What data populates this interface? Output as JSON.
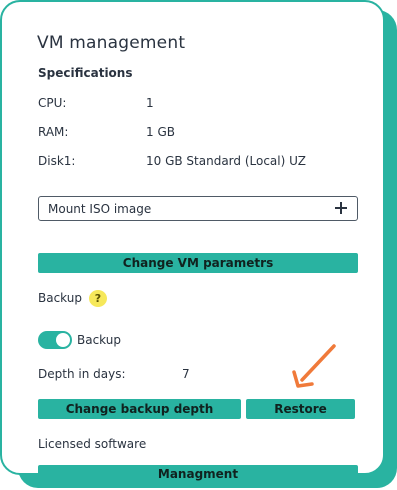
{
  "title": "VM management",
  "specifications": {
    "heading": "Specifications",
    "rows": [
      {
        "label": "CPU:",
        "value": "1"
      },
      {
        "label": "RAM:",
        "value": "1 GB"
      },
      {
        "label": "Disk1:",
        "value": "10 GB Standard (Local) UZ"
      }
    ]
  },
  "mount_iso": {
    "label": "Mount ISO image",
    "icon": "plus-icon"
  },
  "change_vm_button": "Change VM parametrs",
  "backup": {
    "heading": "Backup",
    "help_glyph": "?",
    "toggle_label": "Backup",
    "toggle_on": true,
    "depth_label": "Depth in days:",
    "depth_value": "7",
    "change_depth_button": "Change backup depth",
    "restore_button": "Restore"
  },
  "licensed_software": {
    "heading": "Licensed software",
    "management_button": "Managment"
  },
  "colors": {
    "accent": "#29b3a1",
    "annotation_arrow": "#f07a3a",
    "help_badge": "#f6e85a"
  }
}
